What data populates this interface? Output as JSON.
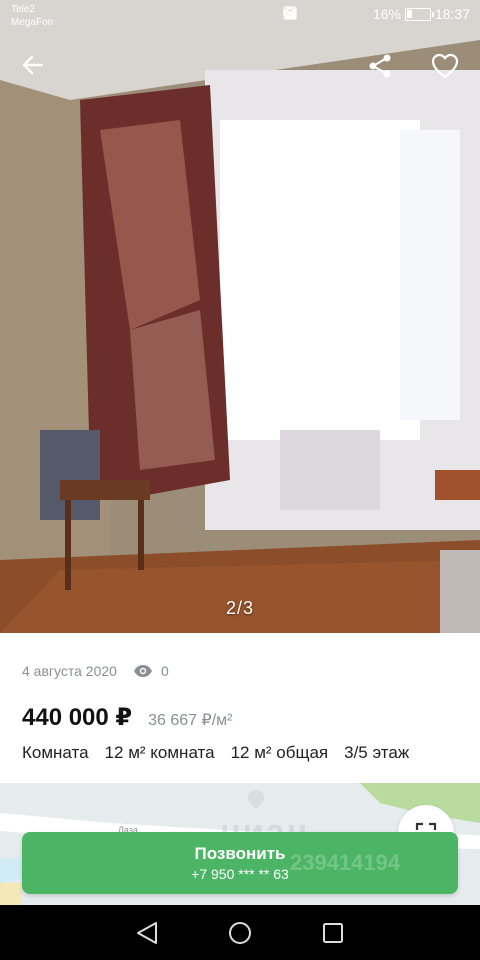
{
  "status_bar": {
    "carrier_1": "Tele2",
    "carrier_2": "MegaFon",
    "battery": "16%",
    "time": "18:37",
    "icons": [
      "hotspot-icon",
      "nfc-icon",
      "alarm-icon",
      "4g-icon",
      "signal-icon",
      "battery-icon"
    ]
  },
  "photo": {
    "counter": "2/3"
  },
  "listing": {
    "date": "4 августа 2020",
    "views": "0",
    "price": "440 000 ₽",
    "price_per_m2": "36 667 ₽/м²",
    "specs": [
      "Комната",
      "12 м² комната",
      "12 м² общая",
      "3/5 этаж"
    ]
  },
  "map": {
    "watermark": "циан",
    "street": "Лаза..."
  },
  "call_button": {
    "label": "Позвонить",
    "phone": "+7 950 *** ** 63",
    "watermark_number": "239414194"
  },
  "colors": {
    "accent_green": "#4cb565",
    "muted_text": "#8a8f95"
  }
}
